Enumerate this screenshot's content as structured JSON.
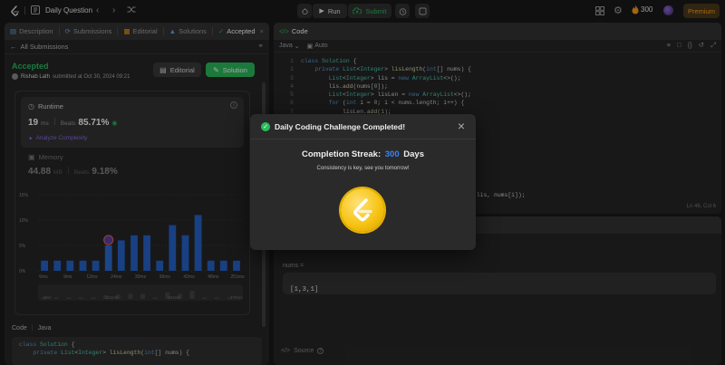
{
  "topbar": {
    "title": "Daily Question",
    "run": "Run",
    "submit": "Submit",
    "streak": "300",
    "premium": "Premium"
  },
  "left": {
    "tabs": [
      {
        "label": "Description",
        "icon": "description-icon"
      },
      {
        "label": "Submissions",
        "icon": "history-icon"
      },
      {
        "label": "Editorial",
        "icon": "book-icon"
      },
      {
        "label": "Solutions",
        "icon": "flask-icon"
      },
      {
        "label": "Accepted",
        "icon": "check-icon",
        "active": true
      }
    ],
    "all_submissions": "All Submissions",
    "status": "Accepted",
    "user": "Rishab Lath",
    "submitted_at": "submitted at Oct 30, 2024 09:21",
    "editorial_btn": "Editorial",
    "solution_btn": "Solution",
    "runtime": {
      "label": "Runtime",
      "value": "19",
      "unit": "ms",
      "beats_label": "Beats",
      "beats": "85.71%",
      "analyze": "Analyze Complexity"
    },
    "memory": {
      "label": "Memory",
      "value": "44.88",
      "unit": "MB",
      "beats_label": "Beats",
      "beats": "9.18%"
    },
    "chart_data": {
      "type": "bar",
      "y_ticks": [
        "15%",
        "10%",
        "5%",
        "0%"
      ],
      "x_ticks": [
        "6ms",
        "9ms",
        "12ms",
        "24ms",
        "30ms",
        "36ms",
        "42ms",
        "48ms",
        "251ms"
      ],
      "values": [
        2,
        2,
        2,
        2,
        2,
        5,
        6,
        7,
        7,
        2,
        9,
        7,
        11,
        2,
        2,
        2
      ],
      "highlight_index": 5,
      "ylim": [
        0,
        15
      ],
      "range_ticks": [
        "3ms",
        "131ms",
        "224ms",
        "378ms"
      ]
    },
    "code_label": "Code",
    "code_lang": "Java",
    "code_preview": [
      "class Solution {",
      "    private List<Integer> lisLength(int[] nums) {"
    ]
  },
  "right": {
    "code_title": "Code",
    "lang": "Java",
    "auto": "Auto",
    "lines": [
      "class Solution {",
      "    private List<Integer> lisLength(int[] nums) {",
      "        List<Integer> lis = new ArrayList<>();",
      "        lis.add(nums[0]);",
      "        List<Integer> lisLen = new ArrayList<>();",
      "        for (int i = 0; i < nums.length; i++) {",
      "            lisLen.add(1);"
    ],
    "frag": "(lis, nums[i]);",
    "position": "Ln 46, Col 6",
    "testcase_label": "nums =",
    "testcase_value": "[1,3,1]",
    "source": "Source"
  },
  "modal": {
    "title": "Daily Coding Challenge Completed!",
    "streak_label": "Completion Streak:",
    "streak_value": "300",
    "streak_unit": "Days",
    "message": "Consistency is key, see you tomorrow!"
  }
}
